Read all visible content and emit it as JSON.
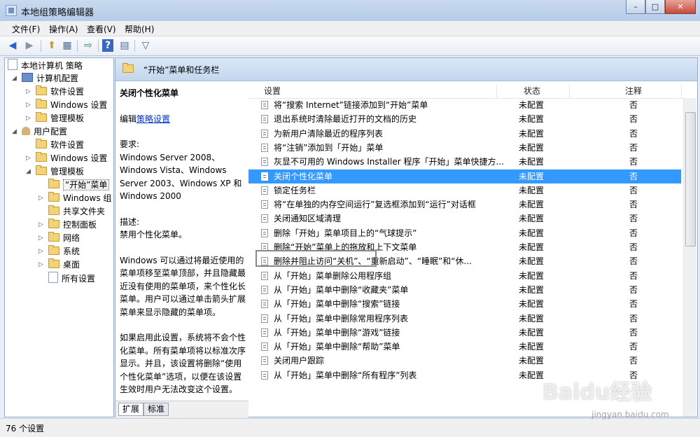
{
  "window": {
    "title": "本地组策略编辑器",
    "btn_min": "–",
    "btn_max": "□",
    "btn_close": "✕"
  },
  "menu": {
    "file": "文件(F)",
    "action": "操作(A)",
    "view": "查看(V)",
    "help": "帮助(H)"
  },
  "toolbar": {
    "back": "◀",
    "forward": "▶",
    "up": "⬆",
    "showtree": "▦",
    "export": "⇨",
    "help": "?",
    "props": "▤",
    "filter": "▽"
  },
  "tree": {
    "root": "本地计算机 策略",
    "computer": "计算机配置",
    "c_software": "软件设置",
    "c_windows": "Windows 设置",
    "c_admin": "管理模板",
    "user": "用户配置",
    "u_software": "软件设置",
    "u_windows": "Windows 设置",
    "u_admin": "管理模板",
    "start_menu": "“开始”菜单",
    "windows_comp": "Windows 组",
    "shared": "共享文件夹",
    "control_panel": "控制面板",
    "network": "网络",
    "system": "系统",
    "desktop": "桌面",
    "all_settings": "所有设置"
  },
  "header": {
    "title": "“开始”菜单和任务栏"
  },
  "description": {
    "title": "关闭个性化菜单",
    "edit_prefix": "编辑",
    "edit_link": "策略设置",
    "req_label": "要求:",
    "req_text": "Windows Server 2008、Windows Vista、Windows Server 2003、Windows XP 和 Windows 2000",
    "desc_label": "描述:",
    "desc_text": "禁用个性化菜单。",
    "para1": "Windows 可以通过将最近使用的菜单项移至菜单顶部，并且隐藏最近没有使用的菜单项，来个性化长菜单。用户可以通过单击箭头扩展菜单来显示隐藏的菜单项。",
    "para2": "如果启用此设置，系统将不会个性化菜单。所有菜单项将以标准次序显示。并且，该设置将删除“使用个性化菜单”选项，以便在该设置生效时用户无法改变这个设置。"
  },
  "columns": {
    "setting": "设置",
    "state": "状态",
    "comment": "注释"
  },
  "rows": [
    {
      "name": "将“搜索 Internet”链接添加到“开始”菜单",
      "state": "未配置",
      "comment": "否"
    },
    {
      "name": "退出系统时清除最近打开的文档的历史",
      "state": "未配置",
      "comment": "否"
    },
    {
      "name": "为新用户清除最近的程序列表",
      "state": "未配置",
      "comment": "否"
    },
    {
      "name": "将“注销”添加到「开始」菜单",
      "state": "未配置",
      "comment": "否"
    },
    {
      "name": "灰显不可用的 Windows Installer 程序「开始」菜单快捷方...",
      "state": "未配置",
      "comment": "否"
    },
    {
      "name": "关闭个性化菜单",
      "state": "未配置",
      "comment": "否"
    },
    {
      "name": "锁定任务栏",
      "state": "未配置",
      "comment": "否"
    },
    {
      "name": "将“在单独的内存空间运行”复选框添加到“运行”对话框",
      "state": "未配置",
      "comment": "否"
    },
    {
      "name": "关闭通知区域清理",
      "state": "未配置",
      "comment": "否"
    },
    {
      "name": "删除「开始」菜单项目上的“气球提示”",
      "state": "未配置",
      "comment": "否"
    },
    {
      "name": "删除“开始”菜单上的拖放和上下文菜单",
      "state": "未配置",
      "comment": "否"
    },
    {
      "name": "删除并阻止访问“关机”、“重新启动”、“睡眠”和“休...",
      "state": "未配置",
      "comment": "否"
    },
    {
      "name": "从「开始」菜单删除公用程序组",
      "state": "未配置",
      "comment": "否"
    },
    {
      "name": "从「开始」菜单中删除“收藏夹”菜单",
      "state": "未配置",
      "comment": "否"
    },
    {
      "name": "从「开始」菜单中删除“搜索”链接",
      "state": "未配置",
      "comment": "否"
    },
    {
      "name": "从「开始」菜单中删除常用程序列表",
      "state": "未配置",
      "comment": "否"
    },
    {
      "name": "从「开始」菜单中删除“游戏”链接",
      "state": "未配置",
      "comment": "否"
    },
    {
      "name": "从「开始」菜单中删除“帮助”菜单",
      "state": "未配置",
      "comment": "否"
    },
    {
      "name": "关闭用户跟踪",
      "state": "未配置",
      "comment": "否"
    },
    {
      "name": "从「开始」菜单中删除“所有程序”列表",
      "state": "未配置",
      "comment": "否"
    }
  ],
  "selected_row": 5,
  "tabs": {
    "extended": "扩展",
    "standard": "标准"
  },
  "status": {
    "text": "76 个设置"
  },
  "watermark": {
    "logo": "Baidu经验",
    "url": "jingyan.baidu.com"
  },
  "colors": {
    "selection": "#3399ff",
    "header_band": "#c3d6ee",
    "link": "#0033cc"
  }
}
